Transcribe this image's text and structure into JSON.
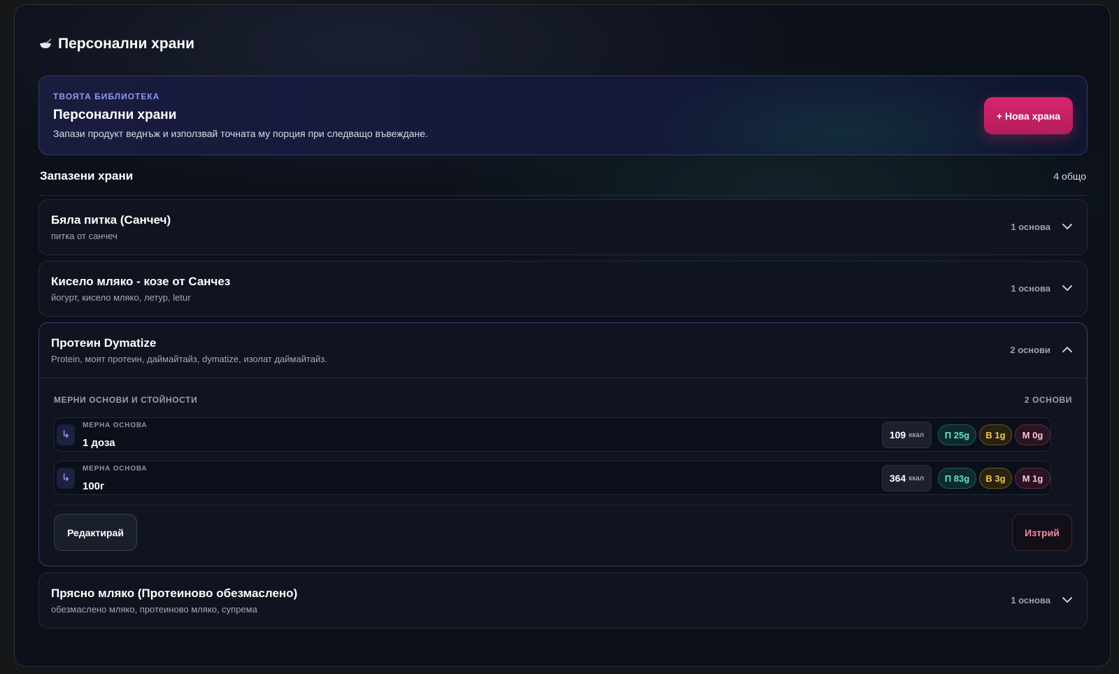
{
  "page": {
    "title": "Персонални храни",
    "icon": "bowl-icon"
  },
  "hero": {
    "eyebrow": "ТВОЯТА БИБЛИОТЕКА",
    "title": "Персонални храни",
    "description": "Запази продукт веднъж и използвай точната му порция при следващо въвеждане.",
    "new_button": "+ Нова храна"
  },
  "saved": {
    "title": "Запазени храни",
    "count": "4",
    "count_suffix": "общо"
  },
  "foods": [
    {
      "name": "Бяла питка (Санчеч)",
      "tags": "питка от санчеч",
      "bases": "1 основа",
      "expanded": false
    },
    {
      "name": "Кисело мляко - козе от Санчез",
      "tags": "йогурт, кисело мляко, летур, letur",
      "bases": "1 основа",
      "expanded": false
    },
    {
      "name": "Протеин Dymatize",
      "tags": "Protein, моят протеин, даймайтайз, dymatize, изолат даймайтайз.",
      "bases": "2 основи",
      "expanded": true,
      "details": {
        "label": "МЕРНИ ОСНОВИ И СТОЙНОСТИ",
        "count": "2 ОСНОВИ",
        "rows": [
          {
            "eyebrow": "МЕРНА ОСНОВА",
            "value": "1 доза",
            "kcal": "109",
            "kcal_unit": "ккал",
            "protein": "П 25g",
            "carbs": "В 1g",
            "fat": "М 0g"
          },
          {
            "eyebrow": "МЕРНА ОСНОВА",
            "value": "100г",
            "kcal": "364",
            "kcal_unit": "ккал",
            "protein": "П 83g",
            "carbs": "В 3g",
            "fat": "М 1g"
          }
        ],
        "edit_button": "Редактирай",
        "delete_button": "Изтрий"
      }
    },
    {
      "name": "Прясно мляко (Протеиново обезмаслено)",
      "tags": "обезмаслено мляко, протеиново мляко, супрема",
      "bases": "1 основа",
      "expanded": false
    }
  ],
  "colors": {
    "accent": "#d6256f",
    "protein": "#5fe3d3",
    "carbs": "#f3c752",
    "fat": "#f4c6dc",
    "delete": "#f28a9e"
  }
}
